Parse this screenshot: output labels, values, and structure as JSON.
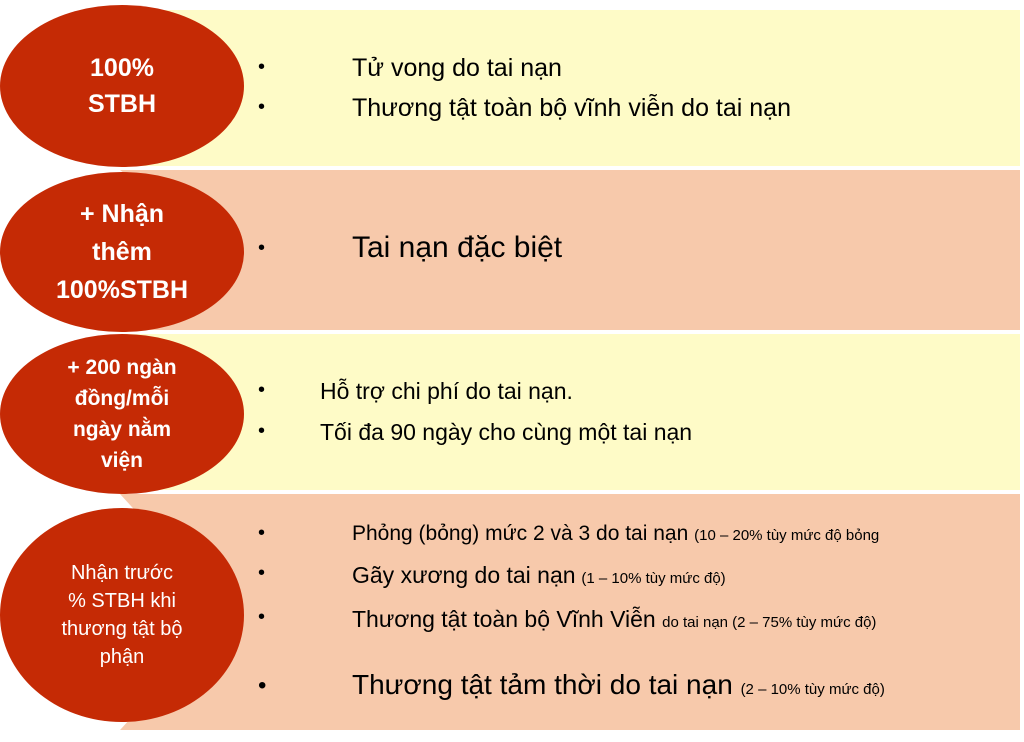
{
  "colors": {
    "bubble": "#c52a05",
    "panel_yellow": "#fefbc7",
    "panel_peach": "#f7c9ab"
  },
  "rows": [
    {
      "label": [
        "100%",
        "STBH"
      ],
      "items": [
        {
          "text": "Tử vong do tai nạn"
        },
        {
          "text": "Thương tật toàn bộ vĩnh viễn do tai nạn"
        }
      ]
    },
    {
      "label": [
        "+ Nhận",
        "thêm",
        "100%STBH"
      ],
      "items": [
        {
          "text": "Tai nạn đặc biệt"
        }
      ]
    },
    {
      "label": [
        "+ 200 ngàn",
        "đồng/mỗi",
        "ngày nằm",
        "viện"
      ],
      "items": [
        {
          "text": "Hỗ trợ chi phí do tai nạn."
        },
        {
          "text": "Tối đa 90 ngày cho cùng một tai nạn"
        }
      ]
    },
    {
      "label": [
        "Nhận trước",
        "% STBH khi",
        "thương tật bộ",
        "phận"
      ],
      "items": [
        {
          "text": "Phỏng (bỏng) mức 2 và 3 do tai nạn",
          "note": "(10 – 20% tùy mức độ bỏng"
        },
        {
          "text": "Gãy xương do tai nạn",
          "note": "(1 – 10% tùy mức độ)"
        },
        {
          "text": "Thương tật toàn bộ Vĩnh Viễn",
          "note": "do tai nạn (2 – 75% tùy mức độ)"
        },
        {
          "text": "Thương tật tảm thời do tai nạn",
          "note": "(2 – 10% tùy mức độ)"
        }
      ]
    }
  ]
}
